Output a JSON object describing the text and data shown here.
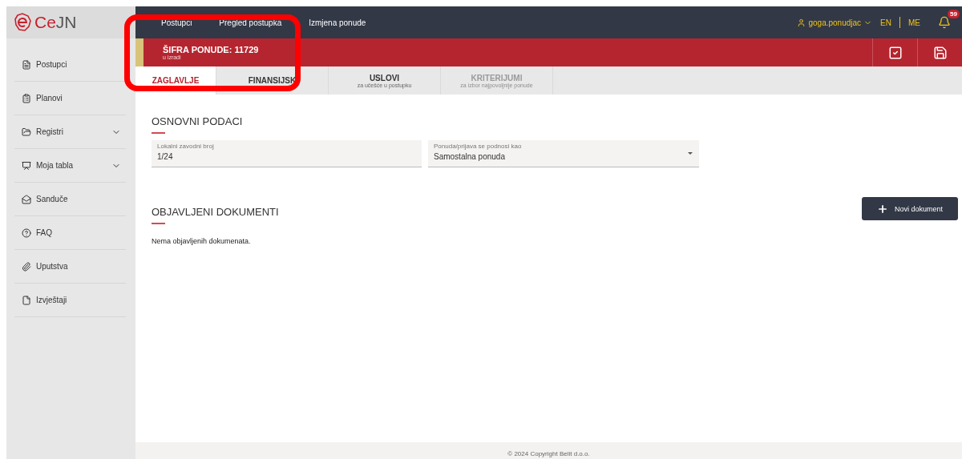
{
  "logo": {
    "text_prefix": "Ce",
    "text_suffix": "JN"
  },
  "sidebar": {
    "items": [
      {
        "label": "Postupci",
        "kind": "link"
      },
      {
        "label": "Planovi",
        "kind": "link"
      },
      {
        "label": "Registri",
        "kind": "group"
      },
      {
        "label": "Moja tabla",
        "kind": "group"
      },
      {
        "label": "Sanduče",
        "kind": "link"
      },
      {
        "label": "FAQ",
        "kind": "link"
      },
      {
        "label": "Uputstva",
        "kind": "link"
      },
      {
        "label": "Izvještaji",
        "kind": "link"
      }
    ]
  },
  "topbar": {
    "breadcrumbs": [
      "Postupci",
      "Pregled postupka",
      "Izmjena ponude"
    ],
    "user": "goga.ponudjac",
    "languages": [
      "EN",
      "ME"
    ],
    "notifications": "59"
  },
  "header": {
    "title": "ŠIFRA PONUDE: 11729",
    "status": "u izradi"
  },
  "tabs": [
    {
      "title": "ZAGLAVLJE",
      "selected": true,
      "disabled": false
    },
    {
      "title": "FINANSIJSK",
      "selected": false,
      "disabled": false
    },
    {
      "title": "USLOVI",
      "subtitle": "za učešće u postupku",
      "selected": false,
      "disabled": false
    },
    {
      "title": "KRITERIJUMI",
      "subtitle": "za izbor najpovoljnije ponude",
      "selected": false,
      "disabled": true
    }
  ],
  "basic": {
    "heading": "OSNOVNI PODACI",
    "fields": [
      {
        "kind": "text",
        "label": "Lokalni zavodni broj",
        "value": "1/24"
      },
      {
        "kind": "select",
        "label": "Ponuda/prijava se podnosi kao",
        "value": "Samostalna ponuda"
      }
    ]
  },
  "documents": {
    "heading": "OBJAVLJENI DOKUMENTI",
    "button": "Novi dokument",
    "empty": "Nema objavljenih dokumenata."
  },
  "footer": "© 2024 Copyright Belit d.o.o."
}
